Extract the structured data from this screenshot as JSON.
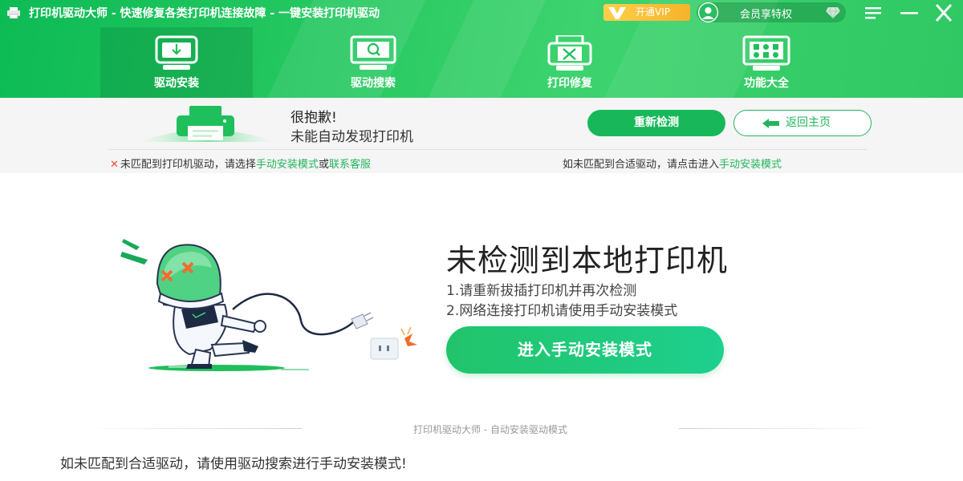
{
  "app": {
    "title": "打印机驱动大师 - 快速修复各类打印机连接故障 - 一键安装打印机驱动"
  },
  "header_actions": {
    "vip_label": "开通VIP",
    "member_label": "会员享特权"
  },
  "nav": {
    "items": [
      {
        "label": "驱动安装",
        "icon": "driver-install-icon",
        "active": true
      },
      {
        "label": "驱动搜索",
        "icon": "driver-search-icon",
        "active": false
      },
      {
        "label": "打印修复",
        "icon": "printer-repair-icon",
        "active": false
      },
      {
        "label": "功能大全",
        "icon": "all-features-icon",
        "active": false
      }
    ]
  },
  "alert": {
    "sorry": "很抱歉!",
    "message": "未能自动发现打印机",
    "redetect_label": "重新检测",
    "home_label": "返回主页",
    "hint_left": {
      "prefix": "未匹配到打印机驱动，请选择",
      "link1": "手动安装模式",
      "middle": "或",
      "link2": "联系客服"
    },
    "hint_right": {
      "prefix": "如未匹配到合适驱动，请点击进入",
      "link": "手动安装模式"
    }
  },
  "main": {
    "title": "未检测到本地打印机",
    "tip1": "1.请重新拔插打印机并再次检测",
    "tip2": "2.网络连接打印机请使用手动安装模式",
    "cta_label": "进入手动安装模式",
    "separator_text": "打印机驱动大师 - 自动安装驱动模式",
    "bottom_text": "如未匹配到合适驱动，请使用驱动搜索进行手动安装模式!"
  },
  "colors": {
    "brand_green": "#1fbf5c",
    "link_green": "#22b55c",
    "vip_gold": "#f5b32a",
    "error_red": "#f04b2c"
  }
}
